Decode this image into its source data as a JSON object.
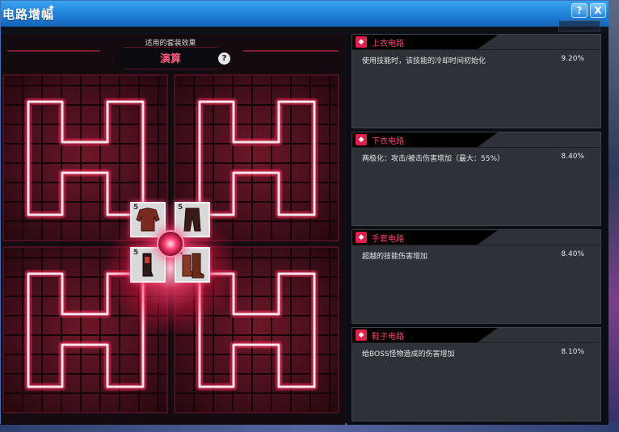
{
  "window": {
    "title": "电路增幅",
    "help_button": "?",
    "close_button": "X"
  },
  "set_effect": {
    "caption": "适用的套装效果",
    "name": "演算",
    "help": "?"
  },
  "slots": [
    {
      "number": "5",
      "item": "top-armor"
    },
    {
      "number": "5",
      "item": "pants"
    },
    {
      "number": "5",
      "item": "gloves"
    },
    {
      "number": "5",
      "item": "shoes"
    }
  ],
  "circuits": [
    {
      "title": "上衣电路",
      "description": "使用技能时，该技能的冷却时间初始化",
      "value": "9.20%"
    },
    {
      "title": "下衣电路",
      "description": "两极化：攻击/被击伤害增加（最大：55%）",
      "value": "8.40%"
    },
    {
      "title": "手套电路",
      "description": "超越的技能伤害增加",
      "value": "8.40%"
    },
    {
      "title": "鞋子电路",
      "description": "给BOSS怪物造成的伤害增加",
      "value": "8.10%"
    }
  ],
  "colors": {
    "accent": "#ff3d6a",
    "circuit_glow": "#ff2a5a",
    "titlebar": "#2a8ee0"
  }
}
